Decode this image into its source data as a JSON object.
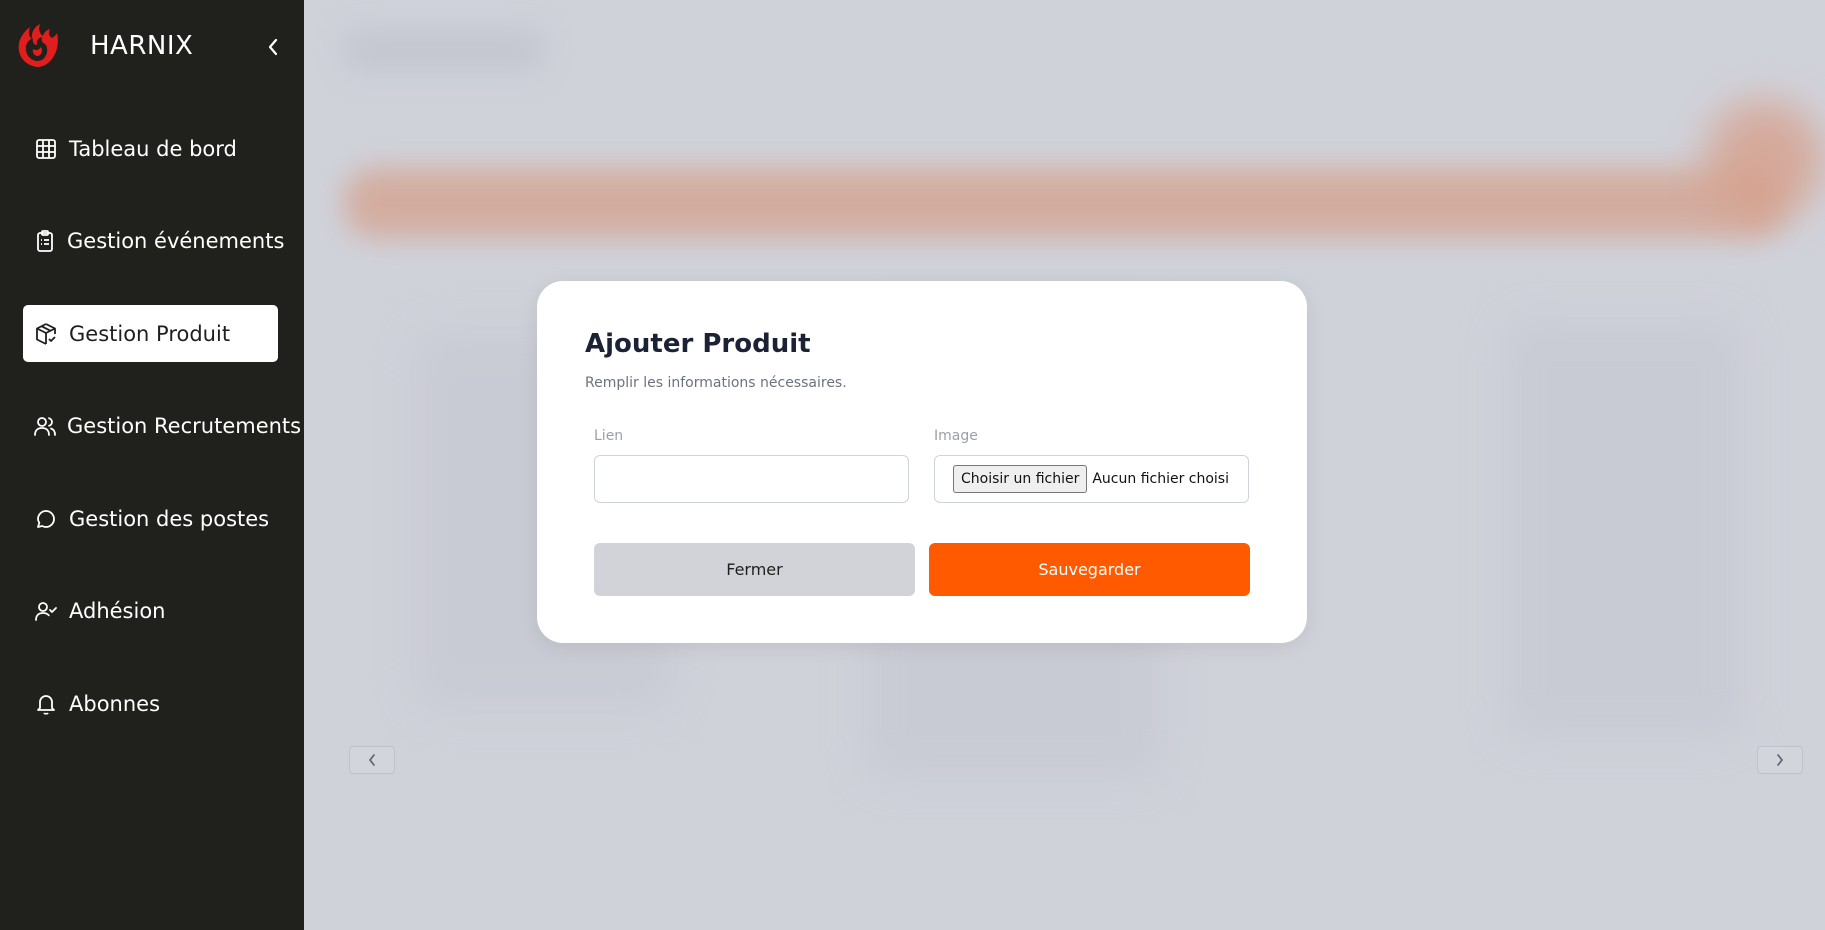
{
  "sidebar": {
    "brand": "HARNIX",
    "items": [
      {
        "label": "Tableau de bord",
        "icon": "grid-table-icon",
        "active": false
      },
      {
        "label": "Gestion événements",
        "icon": "clipboard-list-icon",
        "active": false
      },
      {
        "label": "Gestion Produit",
        "icon": "package-check-icon",
        "active": true
      },
      {
        "label": "Gestion Recrutements",
        "icon": "users-icon",
        "active": false
      },
      {
        "label": "Gestion des postes",
        "icon": "message-circle-icon",
        "active": false
      },
      {
        "label": "Adhésion",
        "icon": "user-check-icon",
        "active": false
      },
      {
        "label": "Abonnes",
        "icon": "bell-icon",
        "active": false
      }
    ]
  },
  "modal": {
    "title": "Ajouter Produit",
    "subtitle": "Remplir les informations nécessaires.",
    "link_label": "Lien",
    "link_value": "",
    "image_label": "Image",
    "file_button": "Choisir un fichier",
    "file_status": "Aucun fichier choisi",
    "close_label": "Fermer",
    "save_label": "Sauvegarder"
  },
  "colors": {
    "sidebar_bg": "#20211c",
    "accent": "#ff5a00",
    "overlay_bg": "#d0d2da",
    "close_button_bg": "#d2d3d8"
  }
}
